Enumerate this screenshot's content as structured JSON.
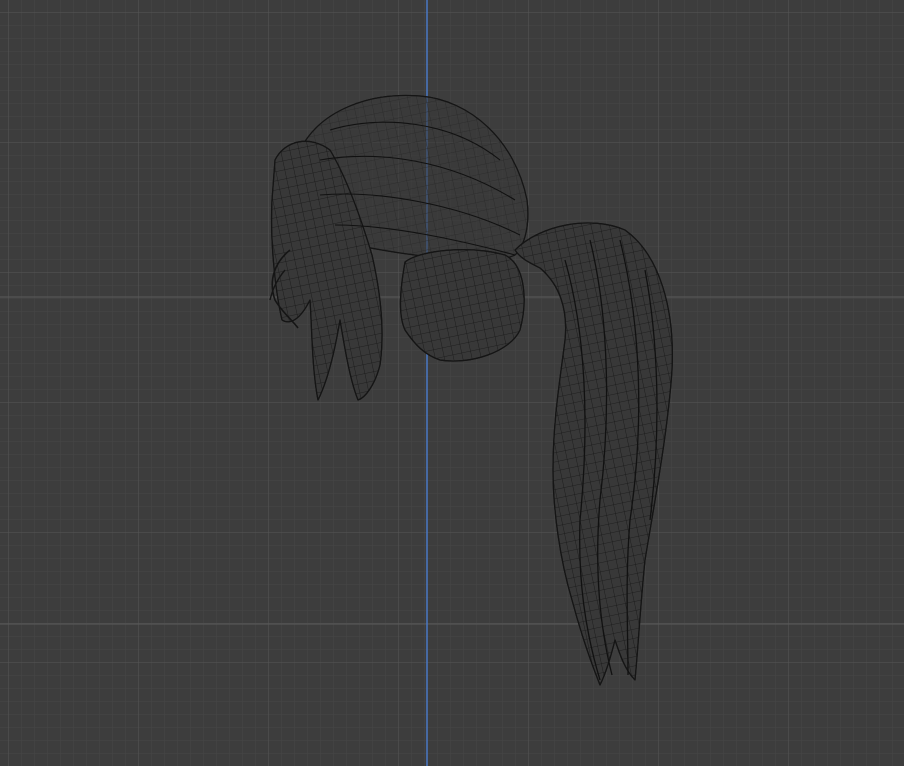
{
  "viewport": {
    "kind": "3d-viewport",
    "view": "wireframe",
    "object": "ponytail-hair-mesh",
    "show_grid": true,
    "colors": {
      "background": "#3d3d3d",
      "grid_minor": "#474747",
      "grid_major": "#555555",
      "axis_vertical": "#4a78c4",
      "mesh_fill": "#3a3a3a",
      "mesh_wire": "#151515"
    }
  }
}
